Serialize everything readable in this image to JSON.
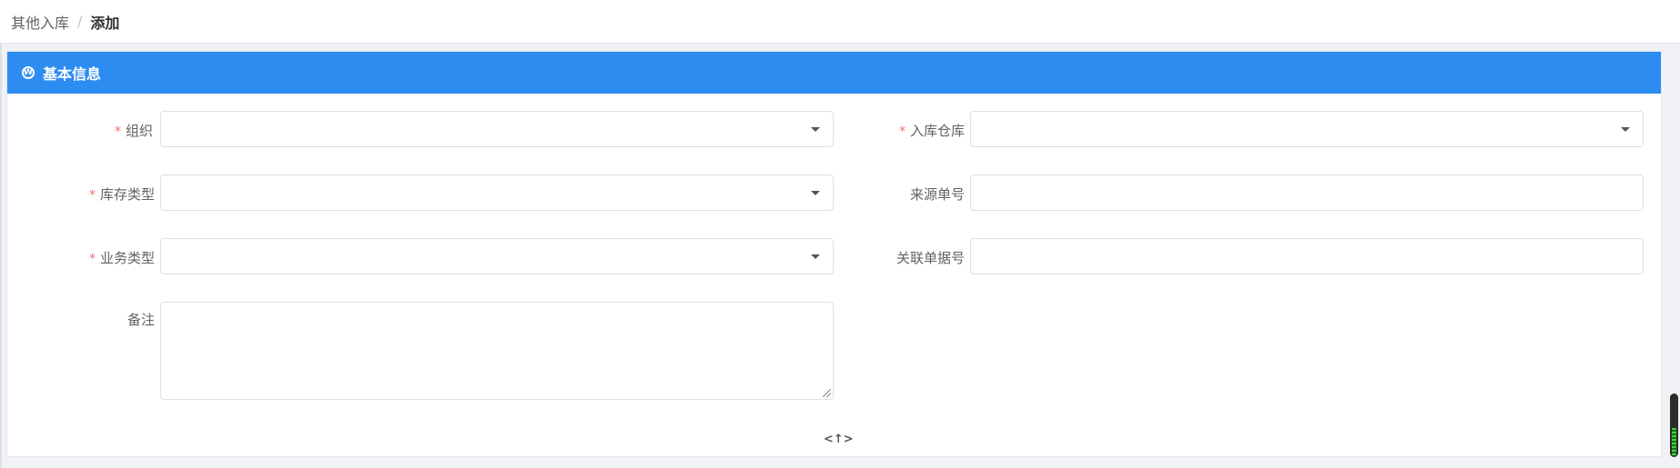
{
  "breadcrumb": {
    "parent": "其他入库",
    "separator": "/",
    "current": "添加"
  },
  "section": {
    "title": "基本信息",
    "icon": "section-icon",
    "icon_glyph": "W"
  },
  "form": {
    "organization": {
      "label": "组织",
      "required_mark": "*",
      "value": "",
      "placeholder": ""
    },
    "warehouse": {
      "label": "入库仓库",
      "required_mark": "*",
      "value": "",
      "placeholder": ""
    },
    "inventory_type": {
      "label": "库存类型",
      "required_mark": "*",
      "value": "",
      "placeholder": ""
    },
    "source_no": {
      "label": "来源单号",
      "value": "",
      "placeholder": ""
    },
    "business_type": {
      "label": "业务类型",
      "required_mark": "*",
      "value": "",
      "placeholder": ""
    },
    "related_no": {
      "label": "关联单据号",
      "value": "",
      "placeholder": ""
    },
    "remark": {
      "label": "备注",
      "value": "",
      "placeholder": ""
    }
  },
  "collapse_toggle": {
    "glyph": "<↑>",
    "icon": "collapse-icon"
  },
  "colors": {
    "header_blue": "#2d8cf0",
    "required_red": "#f56c6c",
    "border": "#dcdfe6"
  }
}
